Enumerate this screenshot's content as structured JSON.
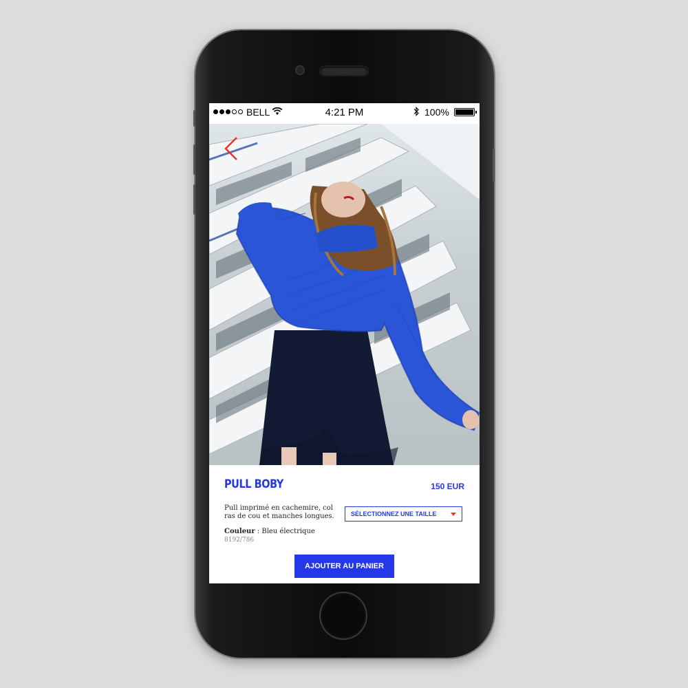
{
  "status_bar": {
    "carrier": "BELL",
    "time": "4:21 PM",
    "battery_percent": "100%",
    "signal_bars_filled": 3,
    "signal_bars_total": 5
  },
  "product": {
    "name": "PULL BOBY",
    "price": "150 EUR",
    "description": "Pull imprimé en cachemire, col ras de cou et manches longues.",
    "color_label": "Couleur",
    "color_separator": " : ",
    "color_value": "Bleu électrique",
    "sku": "8192/786"
  },
  "size_select": {
    "label": "SÉLECTIONNEZ UNE TAILLE"
  },
  "cart_button": {
    "label": "AJOUTER AU PANIER"
  },
  "colors": {
    "brand_blue": "#2438e8",
    "back_arrow": "#e8352a",
    "caret": "#e8352a",
    "sweater_blue": "#2a55d6"
  },
  "icons": {
    "back": "chevron-left-icon",
    "wifi": "wifi-icon",
    "bluetooth": "bluetooth-icon",
    "battery": "battery-icon",
    "dropdown": "caret-down-icon"
  }
}
